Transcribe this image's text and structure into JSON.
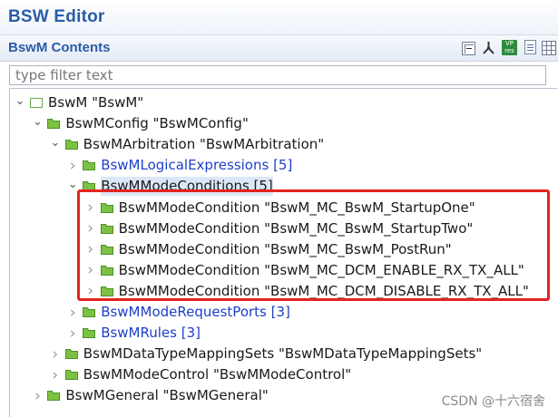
{
  "editor": {
    "title": "BSW Editor"
  },
  "section": {
    "title": "BswM Contents",
    "toolbar": {
      "vp_label": "VP",
      "vp_sub": "res"
    }
  },
  "filter": {
    "placeholder": "type filter text",
    "value": ""
  },
  "tree": [
    {
      "label": "BswM \"BswM\"",
      "level": 0,
      "expanded": true,
      "icon": "module-icon",
      "blue": false
    },
    {
      "label": "BswMConfig \"BswMConfig\"",
      "level": 1,
      "expanded": true,
      "icon": "folder-icon",
      "blue": false
    },
    {
      "label": "BswMArbitration \"BswMArbitration\"",
      "level": 2,
      "expanded": true,
      "icon": "folder-icon",
      "blue": false
    },
    {
      "label": "BswMLogicalExpressions [5]",
      "level": 3,
      "expanded": false,
      "icon": "folder-icon",
      "blue": true
    },
    {
      "label": "BswMModeConditions [5]",
      "level": 3,
      "expanded": true,
      "icon": "folder-icon",
      "blue": false,
      "selected": true
    },
    {
      "label": "BswMModeCondition \"BswM_MC_BswM_StartupOne\"",
      "level": 4,
      "expanded": false,
      "icon": "folder-icon",
      "blue": false
    },
    {
      "label": "BswMModeCondition \"BswM_MC_BswM_StartupTwo\"",
      "level": 4,
      "expanded": false,
      "icon": "folder-icon",
      "blue": false
    },
    {
      "label": "BswMModeCondition \"BswM_MC_BswM_PostRun\"",
      "level": 4,
      "expanded": false,
      "icon": "folder-icon",
      "blue": false
    },
    {
      "label": "BswMModeCondition \"BswM_MC_DCM_ENABLE_RX_TX_ALL\"",
      "level": 4,
      "expanded": false,
      "icon": "folder-icon",
      "blue": false
    },
    {
      "label": "BswMModeCondition \"BswM_MC_DCM_DISABLE_RX_TX_ALL\"",
      "level": 4,
      "expanded": false,
      "icon": "folder-icon",
      "blue": false
    },
    {
      "label": "BswMModeRequestPorts [3]",
      "level": 3,
      "expanded": false,
      "icon": "folder-icon",
      "blue": true
    },
    {
      "label": "BswMRules [3]",
      "level": 3,
      "expanded": false,
      "icon": "folder-icon",
      "blue": true
    },
    {
      "label": "BswMDataTypeMappingSets \"BswMDataTypeMappingSets\"",
      "level": 2,
      "expanded": false,
      "icon": "folder-icon",
      "blue": false
    },
    {
      "label": "BswMModeControl \"BswMModeControl\"",
      "level": 2,
      "expanded": false,
      "icon": "folder-icon",
      "blue": false
    },
    {
      "label": "BswMGeneral \"BswMGeneral\"",
      "level": 1,
      "expanded": false,
      "icon": "folder-icon",
      "blue": false
    }
  ],
  "watermark": "CSDN @十六宿舍",
  "colors": {
    "title_blue": "#2a5ca8",
    "link_blue": "#1e3fc8",
    "folder_green": "#7cc242",
    "highlight_red": "#e3241e"
  }
}
